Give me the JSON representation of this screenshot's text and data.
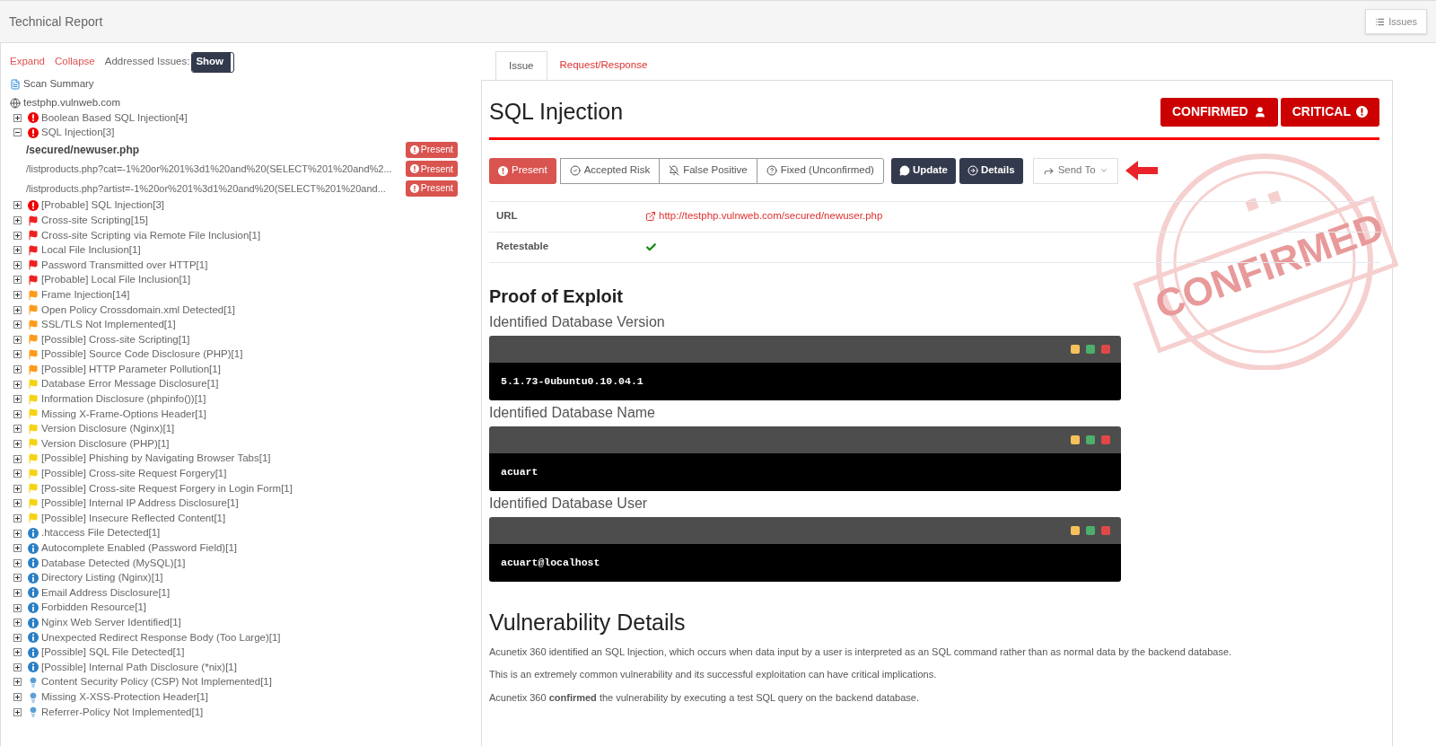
{
  "header": {
    "title": "Technical Report",
    "issues_button": "Issues"
  },
  "sidebar": {
    "expand": "Expand",
    "collapse": "Collapse",
    "addressed_label": "Addressed Issues:",
    "addressed_toggle": "Show",
    "scan_summary": "Scan Summary",
    "host": "testphp.vulnweb.com",
    "items": [
      {
        "label": "Boolean Based SQL Injection[4]",
        "kind": "critical",
        "expanded": false
      },
      {
        "label": "SQL Injection[3]",
        "kind": "critical",
        "expanded": true,
        "children": [
          {
            "label": "/secured/newuser.php",
            "selected": true,
            "status": "Present"
          },
          {
            "label": "/listproducts.php?cat=-1%20or%201%3d1%20and%20(SELECT%201%20and%2...",
            "selected": false,
            "status": "Present"
          },
          {
            "label": "/listproducts.php?artist=-1%20or%201%3d1%20and%20(SELECT%201%20and...",
            "selected": false,
            "status": "Present"
          }
        ]
      },
      {
        "label": "[Probable] SQL Injection[3]",
        "kind": "critical",
        "expanded": false
      },
      {
        "label": "Cross-site Scripting[15]",
        "kind": "high",
        "expanded": false
      },
      {
        "label": "Cross-site Scripting via Remote File Inclusion[1]",
        "kind": "high",
        "expanded": false
      },
      {
        "label": "Local File Inclusion[1]",
        "kind": "high",
        "expanded": false
      },
      {
        "label": "Password Transmitted over HTTP[1]",
        "kind": "high",
        "expanded": false
      },
      {
        "label": "[Probable] Local File Inclusion[1]",
        "kind": "high",
        "expanded": false
      },
      {
        "label": "Frame Injection[14]",
        "kind": "medium",
        "expanded": false
      },
      {
        "label": "Open Policy Crossdomain.xml Detected[1]",
        "kind": "medium",
        "expanded": false
      },
      {
        "label": "SSL/TLS Not Implemented[1]",
        "kind": "medium",
        "expanded": false
      },
      {
        "label": "[Possible] Cross-site Scripting[1]",
        "kind": "medium",
        "expanded": false
      },
      {
        "label": "[Possible] Source Code Disclosure (PHP)[1]",
        "kind": "medium",
        "expanded": false
      },
      {
        "label": "[Possible] HTTP Parameter Pollution[1]",
        "kind": "medium",
        "expanded": false
      },
      {
        "label": "Database Error Message Disclosure[1]",
        "kind": "low",
        "expanded": false
      },
      {
        "label": "Information Disclosure (phpinfo())[1]",
        "kind": "low",
        "expanded": false
      },
      {
        "label": "Missing X-Frame-Options Header[1]",
        "kind": "low",
        "expanded": false
      },
      {
        "label": "Version Disclosure (Nginx)[1]",
        "kind": "low",
        "expanded": false
      },
      {
        "label": "Version Disclosure (PHP)[1]",
        "kind": "low",
        "expanded": false
      },
      {
        "label": "[Possible] Phishing by Navigating Browser Tabs[1]",
        "kind": "low",
        "expanded": false
      },
      {
        "label": "[Possible] Cross-site Request Forgery[1]",
        "kind": "low",
        "expanded": false
      },
      {
        "label": "[Possible] Cross-site Request Forgery in Login Form[1]",
        "kind": "low",
        "expanded": false
      },
      {
        "label": "[Possible] Internal IP Address Disclosure[1]",
        "kind": "low",
        "expanded": false
      },
      {
        "label": "[Possible] Insecure Reflected Content[1]",
        "kind": "low",
        "expanded": false
      },
      {
        "label": ".htaccess File Detected[1]",
        "kind": "info",
        "expanded": false
      },
      {
        "label": "Autocomplete Enabled (Password Field)[1]",
        "kind": "info",
        "expanded": false
      },
      {
        "label": "Database Detected (MySQL)[1]",
        "kind": "info",
        "expanded": false
      },
      {
        "label": "Directory Listing (Nginx)[1]",
        "kind": "info",
        "expanded": false
      },
      {
        "label": "Email Address Disclosure[1]",
        "kind": "info",
        "expanded": false
      },
      {
        "label": "Forbidden Resource[1]",
        "kind": "info",
        "expanded": false
      },
      {
        "label": "Nginx Web Server Identified[1]",
        "kind": "info",
        "expanded": false
      },
      {
        "label": "Unexpected Redirect Response Body (Too Large)[1]",
        "kind": "info",
        "expanded": false
      },
      {
        "label": "[Possible] SQL File Detected[1]",
        "kind": "info",
        "expanded": false
      },
      {
        "label": "[Possible] Internal Path Disclosure (*nix)[1]",
        "kind": "info",
        "expanded": false
      },
      {
        "label": "Content Security Policy (CSP) Not Implemented[1]",
        "kind": "bestpractice",
        "expanded": false
      },
      {
        "label": "Missing X-XSS-Protection Header[1]",
        "kind": "bestpractice",
        "expanded": false
      },
      {
        "label": "Referrer-Policy Not Implemented[1]",
        "kind": "bestpractice",
        "expanded": false
      }
    ]
  },
  "tabs": [
    {
      "label": "Issue",
      "selected": true
    },
    {
      "label": "Request/Response",
      "selected": false
    }
  ],
  "issue": {
    "title": "SQL Injection",
    "badges": [
      {
        "label": "CONFIRMED",
        "kind": "confirmed"
      },
      {
        "label": "CRITICAL",
        "kind": "critical"
      }
    ],
    "stamp": "CONFIRMED",
    "status_buttons": [
      {
        "label": "Present",
        "kind": "present",
        "selected": true
      },
      {
        "label": "Accepted Risk",
        "kind": "accepted",
        "selected": false
      },
      {
        "label": "False Positive",
        "kind": "false_positive",
        "selected": false
      },
      {
        "label": "Fixed (Unconfirmed)",
        "kind": "fixed",
        "selected": false
      }
    ],
    "actions": [
      {
        "label": "Update",
        "kind": "update"
      },
      {
        "label": "Details",
        "kind": "details"
      }
    ],
    "send_to": "Send To",
    "fields": [
      {
        "label": "URL",
        "kind": "link",
        "value": "http://testphp.vulnweb.com/secured/newuser.php"
      },
      {
        "label": "Retestable",
        "kind": "check",
        "checked": true
      }
    ],
    "proof_title": "Proof of Exploit",
    "proofs": [
      {
        "label": "Identified Database Version",
        "value": "5.1.73-0ubuntu0.10.04.1"
      },
      {
        "label": "Identified Database Name",
        "value": "acuart"
      },
      {
        "label": "Identified Database User",
        "value": "acuart@localhost"
      }
    ],
    "details_title": "Vulnerability Details",
    "paragraphs": [
      "Acunetix 360 identified an SQL Injection, which occurs when data input by a user is interpreted as an SQL command rather than as normal data by the backend database.",
      "This is an extremely common vulnerability and its successful exploitation can have critical implications.",
      "Acunetix 360 **confirmed** the vulnerability by executing a test SQL query on the backend database."
    ]
  }
}
